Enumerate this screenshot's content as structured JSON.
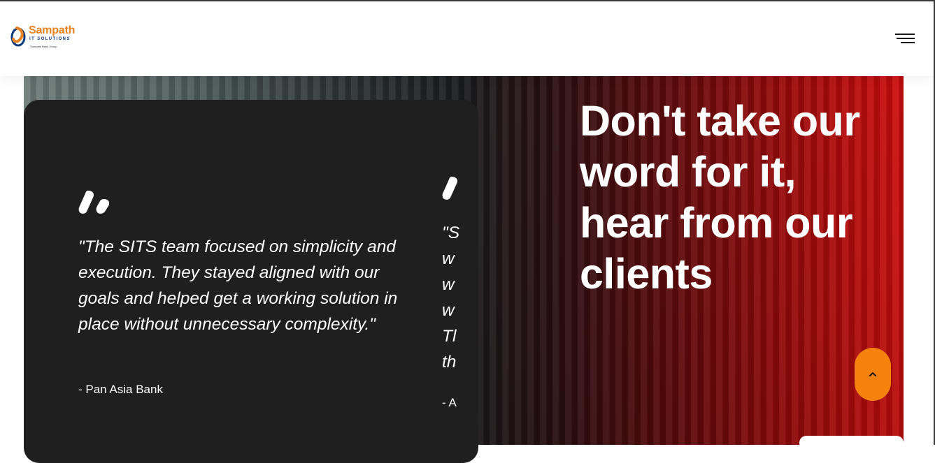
{
  "header": {
    "logo": {
      "brand": "Sampath",
      "subtitle": "IT SOLUTIONS",
      "group_text": "Sampath Bank Group",
      "brand_color": "#e8821f",
      "accent_color": "#0c3a7a"
    },
    "menu_icon": "hamburger-icon"
  },
  "hero": {
    "headline": "Don't take our word for it, hear from our clients"
  },
  "testimonials": [
    {
      "quote": "\"The SITS team focused on simplicity and execution. They stayed aligned with our goals and helped get a working solution in place without unnecessary complexity.\"",
      "author": "- Pan Asia Bank"
    },
    {
      "quote": "\"S\nw\nw\nw\nTl\nth",
      "author": "- A"
    }
  ],
  "scroll_top": {
    "icon": "chevron-up-icon",
    "color": "#f5820d"
  },
  "colors": {
    "card_bg": "#1f1f1f",
    "hero_red": "#cf0d0d"
  }
}
